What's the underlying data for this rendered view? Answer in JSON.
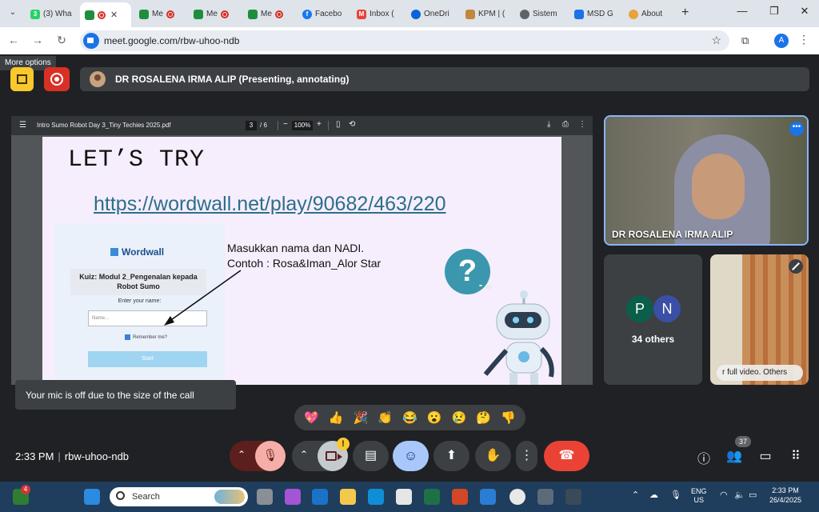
{
  "browser": {
    "tabs": [
      {
        "label": "(3) Wha",
        "favicon": "whatsapp-icon"
      },
      {
        "label": "",
        "favicon": "meet-icon",
        "active": true
      },
      {
        "label": "Me",
        "favicon": "meet-icon"
      },
      {
        "label": "Me",
        "favicon": "meet-icon"
      },
      {
        "label": "Me",
        "favicon": "meet-icon"
      },
      {
        "label": "Facebo",
        "favicon": "facebook-icon"
      },
      {
        "label": "Inbox (",
        "favicon": "gmail-icon"
      },
      {
        "label": "OneDri",
        "favicon": "onedrive-icon"
      },
      {
        "label": "KPM | (",
        "favicon": "kpm-icon"
      },
      {
        "label": "Sistem",
        "favicon": "globe-icon"
      },
      {
        "label": "MSD G",
        "favicon": "msd-icon"
      },
      {
        "label": "About",
        "favicon": "about-icon"
      }
    ],
    "url": "meet.google.com/rbw-uhoo-ndb",
    "profile_initial": "A",
    "tooltip": "More options"
  },
  "meet": {
    "presenter_label": "DR ROSALENA IRMA ALIP (Presenting, annotating)",
    "main_participant": "DR ROSALENA IRMA ALIP",
    "others_avatars": [
      "P",
      "N"
    ],
    "others_count": "34 others",
    "self_tile_text": "r full video. Others",
    "toast": "Your mic is off due to the size of the call",
    "reactions": [
      "💖",
      "👍",
      "🎉",
      "👏",
      "😂",
      "😮",
      "😢",
      "🤔",
      "👎"
    ],
    "time": "2:33 PM",
    "meeting_code": "rbw-uhoo-ndb",
    "people_count": "37",
    "camera_warning": "!"
  },
  "pdf": {
    "filename": "Intro Sumo Robot Day 3_Tiny Techies 2025.pdf",
    "page_current": "3",
    "page_total": "/  6",
    "zoom": "100%"
  },
  "slide": {
    "heading": "LET’S TRY",
    "link": "https://wordwall.net/play/90682/463/220",
    "instruction_line1": "Masukkan nama dan NADI.",
    "instruction_line2": "Contoh : Rosa&Iman_Alor Star",
    "question_mark": "?",
    "card": {
      "brand": "Wordwall",
      "quiz_title": "Kuiz: Modul 2_Pengenalan kepada Robot Sumo",
      "prompt": "Enter your name:",
      "name_placeholder": "Name...",
      "remember": "Remember me?",
      "start": "Start"
    }
  },
  "taskbar": {
    "search_label": "Search",
    "notification_badge": "4",
    "language_line1": "ENG",
    "language_line2": "US",
    "clock_time": "2:33 PM",
    "clock_date": "26/4/2025"
  }
}
